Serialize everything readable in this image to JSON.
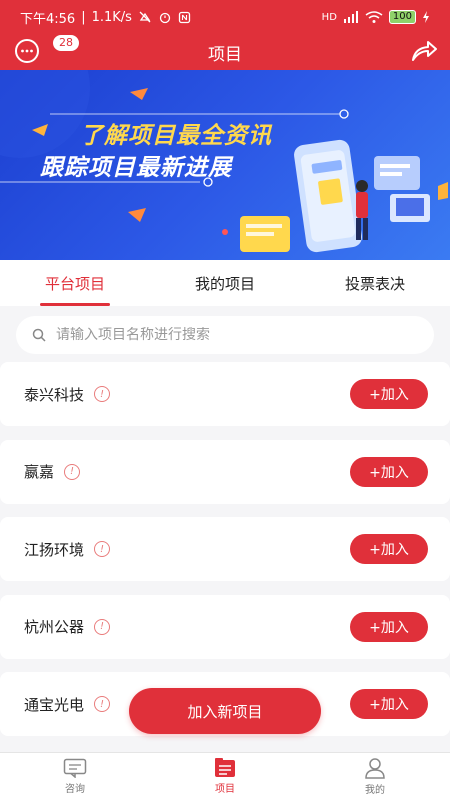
{
  "status_bar": {
    "time": "下午4:56",
    "speed": "1.1K/s",
    "battery": "100"
  },
  "header": {
    "title": "项目",
    "message_badge": "28"
  },
  "banner": {
    "line1": "了解项目最全资讯",
    "line2": "跟踪项目最新进展"
  },
  "tabs": [
    {
      "label": "平台项目",
      "active": true
    },
    {
      "label": "我的项目",
      "active": false
    },
    {
      "label": "投票表决",
      "active": false
    }
  ],
  "search": {
    "placeholder": "请输入项目名称进行搜索",
    "value": ""
  },
  "projects": [
    {
      "name": "泰兴科技",
      "join_label": "+加入"
    },
    {
      "name": "嬴嘉",
      "join_label": "+加入"
    },
    {
      "name": "江扬环境",
      "join_label": "+加入"
    },
    {
      "name": "杭州公器",
      "join_label": "+加入"
    },
    {
      "name": "通宝光电",
      "join_label": "+加入"
    }
  ],
  "add_new_label": "加入新项目",
  "bottom_nav": [
    {
      "label": "咨询",
      "icon": "chat-icon",
      "active": false
    },
    {
      "label": "项目",
      "icon": "project-icon",
      "active": true
    },
    {
      "label": "我的",
      "icon": "user-icon",
      "active": false
    }
  ],
  "colors": {
    "primary": "#e0303a",
    "banner_blue": "#2c58e6",
    "banner_yellow": "#ffd84d"
  }
}
